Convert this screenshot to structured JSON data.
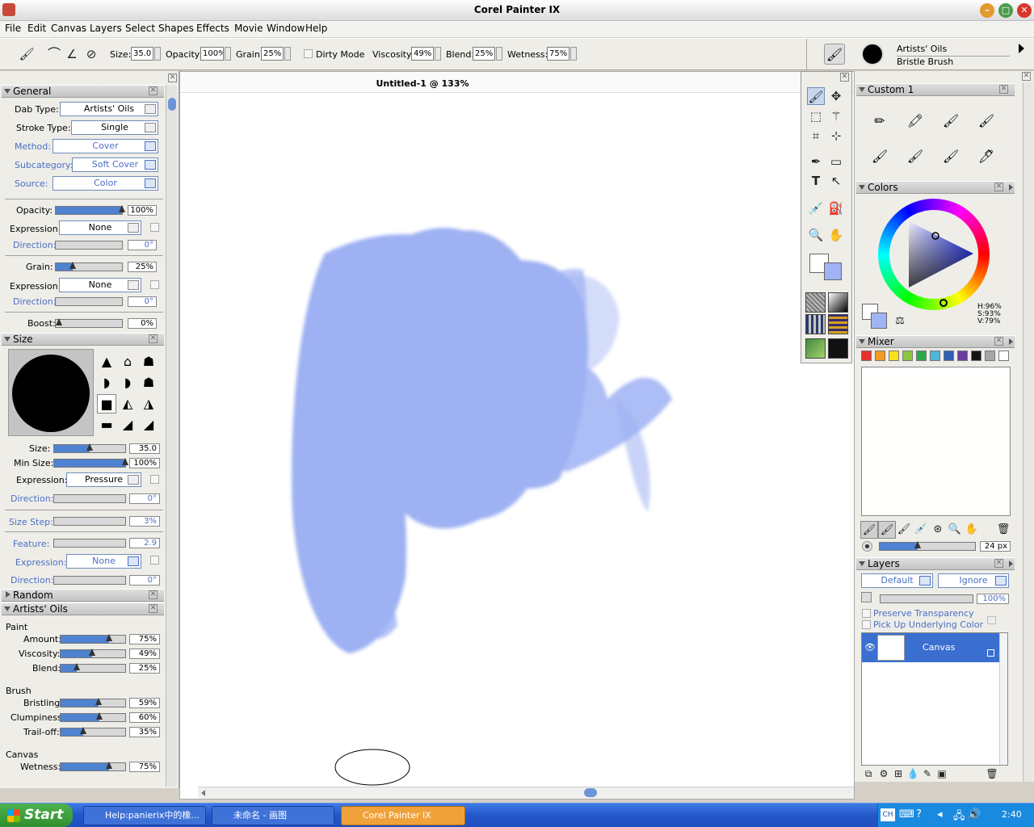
{
  "window": {
    "title": "Corel Painter IX"
  },
  "menu": [
    "File",
    "Edit",
    "Canvas",
    "Layers",
    "Select",
    "Shapes",
    "Effects",
    "Movie",
    "Window",
    "Help"
  ],
  "propbar": {
    "size_label": "Size:",
    "size_value": "35.0",
    "opacity_label": "Opacity:",
    "opacity_value": "100%",
    "grain_label": "Grain:",
    "grain_value": "25%",
    "dirty_mode_label": "Dirty Mode",
    "viscosity_label": "Viscosity:",
    "viscosity_value": "49%",
    "blend_label": "Blend:",
    "blend_value": "25%",
    "wetness_label": "Wetness:",
    "wetness_value": "75%",
    "brush_category": "Artists' Oils",
    "brush_variant": "Bristle Brush"
  },
  "general_panel": {
    "title": "General",
    "dab_type_label": "Dab Type:",
    "dab_type": "Artists' Oils",
    "stroke_type_label": "Stroke Type:",
    "stroke_type": "Single",
    "method_label": "Method:",
    "method": "Cover",
    "subcategory_label": "Subcategory:",
    "subcategory": "Soft Cover",
    "source_label": "Source:",
    "source": "Color",
    "opacity_label": "Opacity:",
    "opacity_value": "100%",
    "opacity_level": 1.0,
    "expression_label": "Expression:",
    "expression1": "None",
    "direction_label": "Direction:",
    "direction1": "0°",
    "grain_label": "Grain:",
    "grain_value": "25%",
    "grain_level": 0.25,
    "expression2": "None",
    "direction2": "0°",
    "boost_label": "Boost:",
    "boost_value": "0%",
    "boost_level": 0.0
  },
  "size_panel": {
    "title": "Size",
    "size_label": "Size:",
    "size_value": "35.0",
    "size_level": 0.5,
    "min_size_label": "Min Size:",
    "min_size_value": "100%",
    "min_size_level": 1.0,
    "expression_label": "Expression:",
    "expression1": "Pressure",
    "direction_label": "Direction:",
    "direction1": "0°",
    "size_step_label": "Size Step:",
    "size_step_value": "3%",
    "feature_label": "Feature:",
    "feature_value": "2.9",
    "expression2": "None",
    "direction2": "0°"
  },
  "random_panel": {
    "title": "Random"
  },
  "oils_panel": {
    "title": "Artists' Oils",
    "paint_heading": "Paint",
    "amount_label": "Amount:",
    "amount_value": "75%",
    "amount_level": 0.75,
    "viscosity_label": "Viscosity:",
    "viscosity_value": "49%",
    "viscosity_level": 0.49,
    "blend_label": "Blend:",
    "blend_value": "25%",
    "blend_level": 0.25,
    "brush_heading": "Brush",
    "bristling_label": "Bristling:",
    "bristling_value": "59%",
    "bristling_level": 0.59,
    "clumpiness_label": "Clumpiness:",
    "clumpiness_value": "60%",
    "clumpiness_level": 0.6,
    "trailoff_label": "Trail-off:",
    "trailoff_value": "35%",
    "trailoff_level": 0.35,
    "canvas_heading": "Canvas",
    "wetness_label": "Wetness:",
    "wetness_value": "75%",
    "wetness_level": 0.75
  },
  "document": {
    "title": "Untitled-1 @ 133%",
    "paint_color": "#99adf2"
  },
  "custom_panel": {
    "title": "Custom  1"
  },
  "colors_panel": {
    "title": "Colors",
    "h": "H:96%",
    "s": "S:93%",
    "v": "V:79%",
    "main_color": "#ffffff",
    "secondary_color": "#9fb3f5"
  },
  "mixer_panel": {
    "title": "Mixer",
    "swatches": [
      "#e8312c",
      "#f29b1f",
      "#f6e21c",
      "#8cc63f",
      "#2aa84a",
      "#4fb6d8",
      "#2f5fb4",
      "#6a3c9c",
      "#141414",
      "#a5a5a5",
      "#ffffff"
    ],
    "brush_size": "24 px",
    "brush_level": 0.4
  },
  "layers_panel": {
    "title": "Layers",
    "composite_method": "Default",
    "composite_depth": "Ignore",
    "opacity_value": "100%",
    "preserve_transparency": "Preserve Transparency",
    "pick_up_underlying": "Pick Up Underlying Color",
    "layer_name": "Canvas"
  },
  "taskbar": {
    "start_label": "Start",
    "task1": "Help:panierix中的橡...",
    "task2": "未命名 - 画图",
    "task3": "Corel Painter IX",
    "clock": "2:40",
    "lang": "CH"
  }
}
